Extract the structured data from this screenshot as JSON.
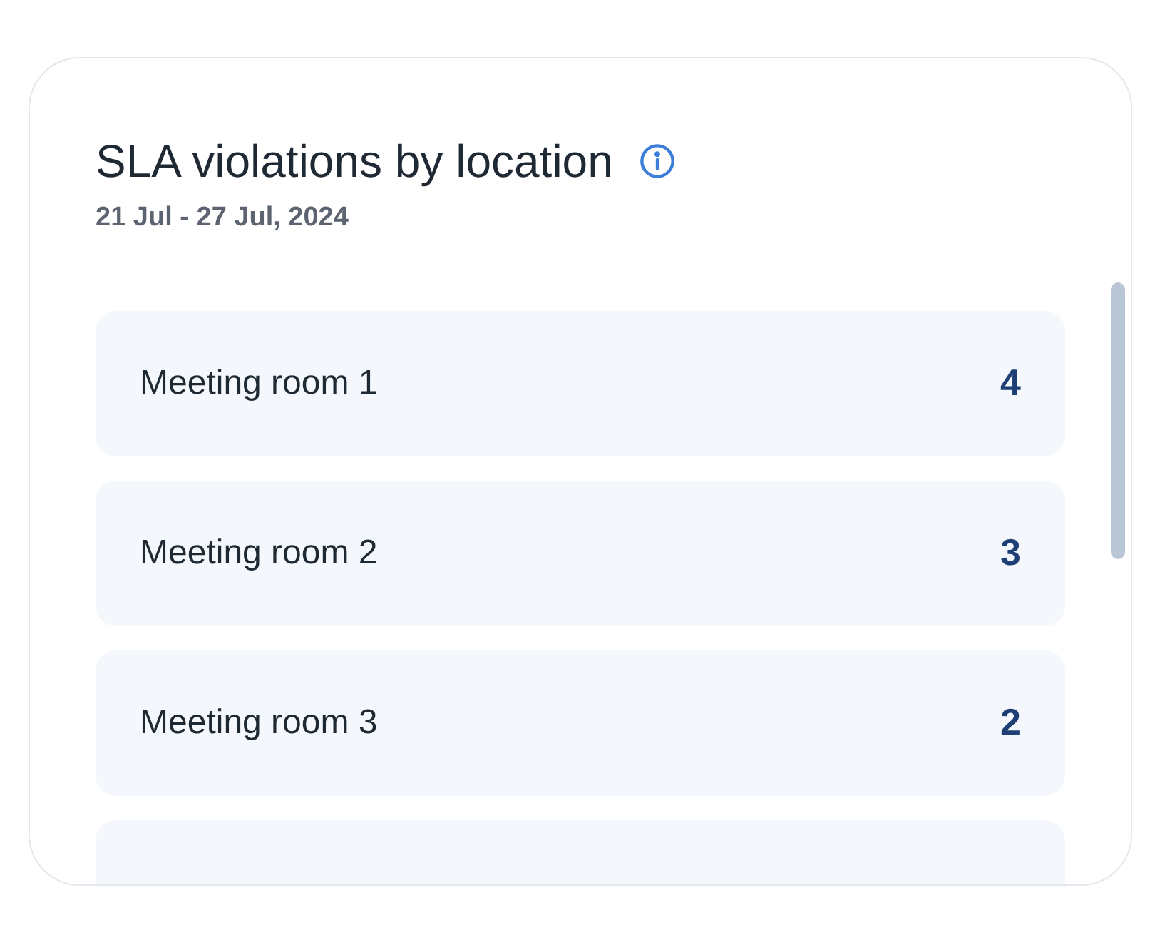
{
  "card": {
    "title": "SLA violations by location",
    "date_range": "21 Jul - 27 Jul, 2024",
    "rows": [
      {
        "name": "Meeting room 1",
        "count": "4"
      },
      {
        "name": "Meeting room 2",
        "count": "3"
      },
      {
        "name": "Meeting room 3",
        "count": "2"
      }
    ]
  }
}
